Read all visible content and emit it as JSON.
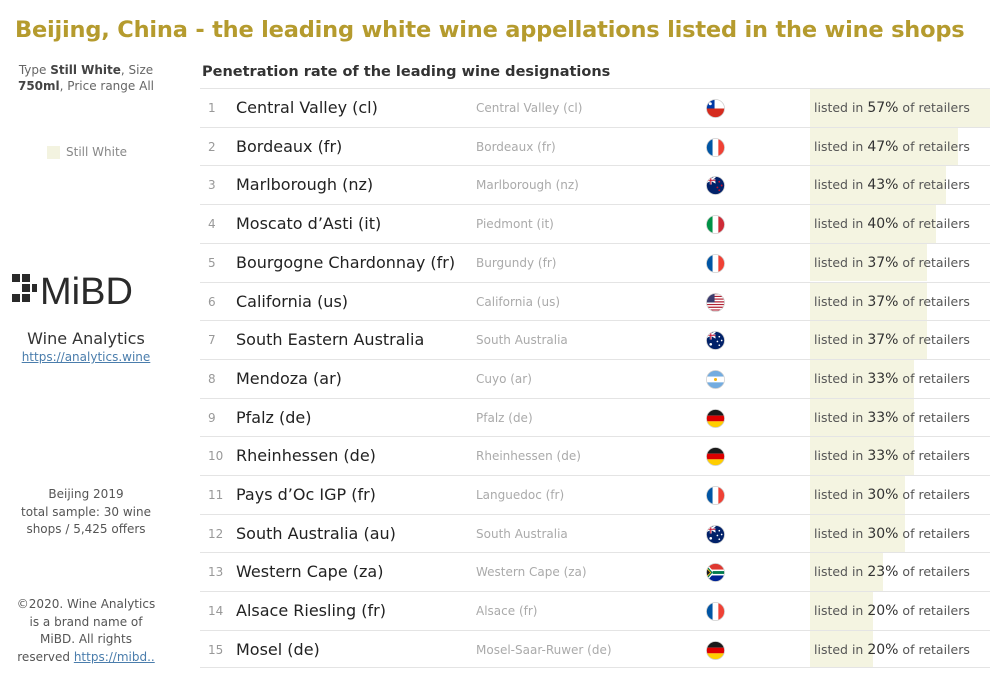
{
  "header": {
    "title": "Beijing, China - the leading white wine appellations listed in the wine shops"
  },
  "filters": {
    "type_label": "Type",
    "type_value": "Still White",
    "size_label": "Size",
    "size_value": "750ml",
    "price_label": "Price range",
    "price_value": "All"
  },
  "legend": {
    "label": "Still White",
    "color": "#f3f3e0"
  },
  "brand": {
    "name": "Wine Analytics",
    "link": "https://analytics.wine",
    "logo_text": "MiBD"
  },
  "sample": {
    "line1": "Beijing 2019",
    "line2": "total sample: 30 wine",
    "line3": "shops  / 5,425 offers"
  },
  "copyright": {
    "line1": "©2020. Wine Analytics",
    "line2": "is a brand name of",
    "line3": "MiBD. All rights",
    "line4_text": "reserved",
    "line4_link": "https://mibd.."
  },
  "colors": {
    "title": "#b59b2e",
    "bar": "#f4f4e1",
    "link": "#4a7dac"
  },
  "chart_data": {
    "type": "table",
    "title": "Penetration rate of the leading wine designations",
    "label_prefix": "listed in",
    "label_suffix": "of retailers",
    "unit": "%",
    "rows": [
      {
        "rank": "1",
        "name": "Central Valley (cl)",
        "region": "Central Valley (cl)",
        "country": "cl",
        "value": 57
      },
      {
        "rank": "2",
        "name": "Bordeaux (fr)",
        "region": "Bordeaux (fr)",
        "country": "fr",
        "value": 47
      },
      {
        "rank": "3",
        "name": "Marlborough (nz)",
        "region": "Marlborough (nz)",
        "country": "nz",
        "value": 43
      },
      {
        "rank": "4",
        "name": "Moscato d’Asti (it)",
        "region": "Piedmont (it)",
        "country": "it",
        "value": 40
      },
      {
        "rank": "5",
        "name": "Bourgogne Chardonnay (fr)",
        "region": "Burgundy (fr)",
        "country": "fr",
        "value": 37
      },
      {
        "rank": "6",
        "name": "California (us)",
        "region": "California (us)",
        "country": "us",
        "value": 37
      },
      {
        "rank": "7",
        "name": "South Eastern Australia",
        "region": "South Australia",
        "country": "au",
        "value": 37
      },
      {
        "rank": "8",
        "name": "Mendoza (ar)",
        "region": "Cuyo (ar)",
        "country": "ar",
        "value": 33
      },
      {
        "rank": "9",
        "name": "Pfalz (de)",
        "region": "Pfalz (de)",
        "country": "de",
        "value": 33
      },
      {
        "rank": "10",
        "name": "Rheinhessen (de)",
        "region": "Rheinhessen (de)",
        "country": "de",
        "value": 33
      },
      {
        "rank": "11",
        "name": "Pays d’Oc IGP (fr)",
        "region": "Languedoc (fr)",
        "country": "fr",
        "value": 30
      },
      {
        "rank": "12",
        "name": "South Australia (au)",
        "region": "South Australia",
        "country": "au",
        "value": 30
      },
      {
        "rank": "13",
        "name": "Western Cape (za)",
        "region": "Western Cape (za)",
        "country": "za",
        "value": 23
      },
      {
        "rank": "14",
        "name": "Alsace Riesling (fr)",
        "region": "Alsace (fr)",
        "country": "fr",
        "value": 20
      },
      {
        "rank": "15",
        "name": "Mosel (de)",
        "region": "Mosel-Saar-Ruwer (de)",
        "country": "de",
        "value": 20
      }
    ]
  }
}
